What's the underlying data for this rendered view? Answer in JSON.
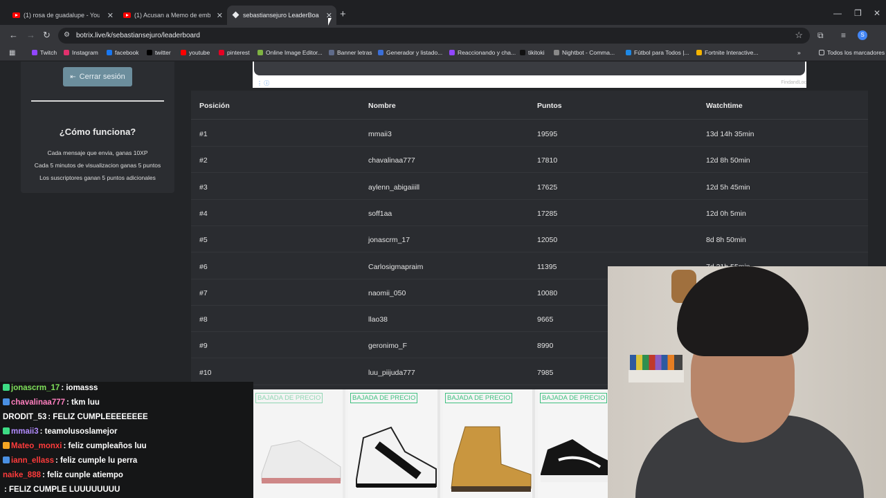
{
  "browser": {
    "tabs": [
      {
        "title": "(1) rosa de guadalupe - YouTube",
        "favicon": "youtube-icon",
        "active": false
      },
      {
        "title": "(1) Acusan a Memo de embarazar",
        "favicon": "youtube-icon",
        "active": false
      },
      {
        "title": "sebastiansejuro LeaderBoard | Botrix",
        "favicon": "botrix-icon",
        "active": true
      }
    ],
    "url": "botrix.live/k/sebastiansejuro/leaderboard",
    "bookmarks": [
      {
        "label": "Twitch",
        "color": "#9146ff"
      },
      {
        "label": "Instagram",
        "color": "#e1306c"
      },
      {
        "label": "facebook",
        "color": "#1877f2"
      },
      {
        "label": "twitter",
        "color": "#000000"
      },
      {
        "label": "youtube",
        "color": "#ff0000"
      },
      {
        "label": "pinterest",
        "color": "#e60023"
      },
      {
        "label": "Online Image Editor...",
        "color": "#7fb342"
      },
      {
        "label": "Banner letras",
        "color": "#5f6b8a"
      },
      {
        "label": "Generador y listado...",
        "color": "#3b6fd8"
      },
      {
        "label": "Reaccionando y cha...",
        "color": "#9146ff"
      },
      {
        "label": "tikitoki",
        "color": "#111111"
      },
      {
        "label": "Nightbot - Comma...",
        "color": "#888888"
      },
      {
        "label": "Fútbol para Todos |...",
        "color": "#1e88e5"
      },
      {
        "label": "Fortnite Interactive...",
        "color": "#f5b400"
      }
    ],
    "all_bookmarks": "Todos los marcadores",
    "profile_initial": "S"
  },
  "sidebar": {
    "logout_label": "Cerrar sesión",
    "how_title": "¿Cómo funciona?",
    "how_lines": [
      "Cada mensaje que envia, ganas 10XP",
      "Cada 5 minutos de visualizacion ganas 5 puntos",
      "Los suscriptores ganan 5 puntos adicionales"
    ]
  },
  "ad": {
    "brand": "FindandLoc"
  },
  "leaderboard": {
    "headers": {
      "position": "Posición",
      "name": "Nombre",
      "points": "Puntos",
      "watchtime": "Watchtime"
    },
    "rows": [
      {
        "position": "#1",
        "name": "mmaii3",
        "points": "19595",
        "watchtime": "13d 14h 35min"
      },
      {
        "position": "#2",
        "name": "chavalinaa777",
        "points": "17810",
        "watchtime": "12d 8h 50min"
      },
      {
        "position": "#3",
        "name": "aylenn_abigaiiill",
        "points": "17625",
        "watchtime": "12d 5h 45min"
      },
      {
        "position": "#4",
        "name": "soff1aa",
        "points": "17285",
        "watchtime": "12d 0h 5min"
      },
      {
        "position": "#5",
        "name": "jonascrm_17",
        "points": "12050",
        "watchtime": "8d 8h 50min"
      },
      {
        "position": "#6",
        "name": "Carlosigmapraim",
        "points": "11395",
        "watchtime": "7d 21h 55min"
      },
      {
        "position": "#7",
        "name": "naomii_050",
        "points": "10080",
        "watchtime": ""
      },
      {
        "position": "#8",
        "name": "llao38",
        "points": "9665",
        "watchtime": ""
      },
      {
        "position": "#9",
        "name": "geronimo_F",
        "points": "8990",
        "watchtime": ""
      },
      {
        "position": "#10",
        "name": "luu_piijuda777",
        "points": "7985",
        "watchtime": ""
      }
    ]
  },
  "chat": [
    {
      "user": "jonascrm_17",
      "message": ": iomasss",
      "color": "#7fe05a"
    },
    {
      "user": "chavalinaa777",
      "message": ": tkm luu",
      "color": "#ff7fbf"
    },
    {
      "user": "DRODIT_53",
      "message": ": FELIZ CUMPLEEEEEEEE",
      "color": "#ffffff"
    },
    {
      "user": "mmaii3",
      "message": ": teamolusoslamejor",
      "color": "#b38cff"
    },
    {
      "user": "Mateo_monxi",
      "message": ": feliz cumpleaños luu",
      "color": "#ff3b3b"
    },
    {
      "user": "iann_ellass",
      "message": ": feliz cumple lu perra",
      "color": "#ff3b3b"
    },
    {
      "user": "naike_888",
      "message": ": feliz cunple atiempo",
      "color": "#ff3b3b"
    },
    {
      "user": "",
      "message": ": FELIZ CUMPLE LUUUUUUUU",
      "color": "#ffffff"
    }
  ],
  "shop": {
    "tag": "BAJADA DE PRECIO",
    "items": [
      "white-red-sneaker",
      "white-black-hightop",
      "tan-boot",
      "black-white-sneaker"
    ]
  }
}
